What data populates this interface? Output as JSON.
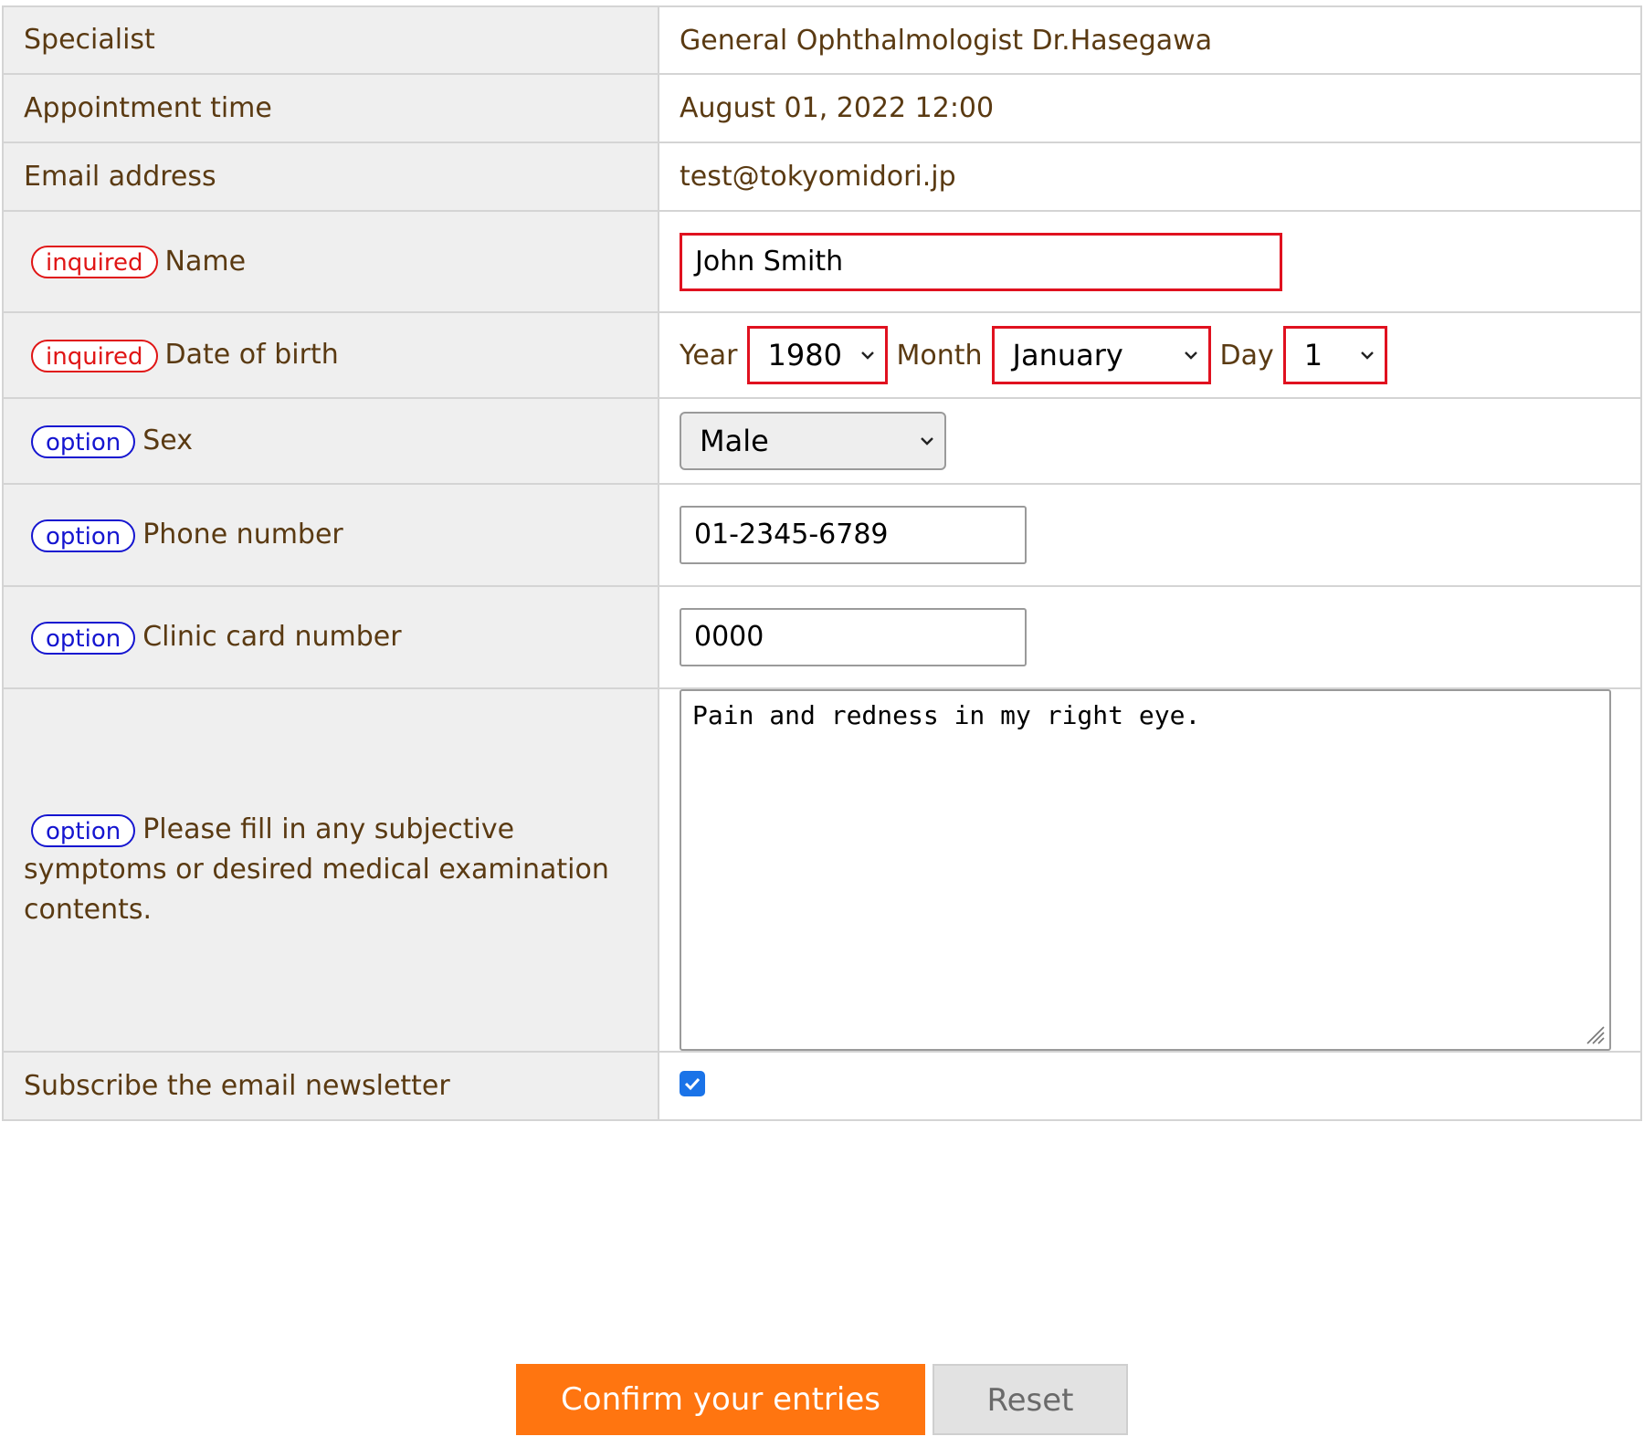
{
  "rows": {
    "specialist": {
      "label": "Specialist",
      "value": "General Ophthalmologist Dr.Hasegawa"
    },
    "appointment": {
      "label": "Appointment time",
      "value": "August 01, 2022 12:00"
    },
    "email": {
      "label": "Email address",
      "value": "test@tokyomidori.jp"
    },
    "name": {
      "badge": "inquired",
      "label": "Name",
      "value": "John Smith"
    },
    "dob": {
      "badge": "inquired",
      "label": "Date of birth",
      "year_label": "Year",
      "year_value": "1980",
      "month_label": "Month",
      "month_value": "January",
      "day_label": "Day",
      "day_value": "1"
    },
    "sex": {
      "badge": "option",
      "label": "Sex",
      "value": "Male"
    },
    "phone": {
      "badge": "option",
      "label": "Phone number",
      "value": "01-2345-6789"
    },
    "card": {
      "badge": "option",
      "label": "Clinic card number",
      "value": "0000"
    },
    "symptoms": {
      "badge": "option",
      "label": "Please fill in any subjective symptoms or desired medical examination contents.",
      "value": "Pain and redness in my right eye."
    },
    "newsletter": {
      "label": "Subscribe the email newsletter",
      "checked": true
    }
  },
  "buttons": {
    "confirm": "Confirm your entries",
    "reset": "Reset"
  },
  "colors": {
    "required": "#e01515",
    "optional": "#1515d0",
    "label_text": "#5a3a12",
    "confirm_button": "#ff7510",
    "checkbox": "#1a73e8"
  },
  "icons": [
    "chevron-down-icon",
    "check-icon",
    "resize-handle-icon"
  ]
}
